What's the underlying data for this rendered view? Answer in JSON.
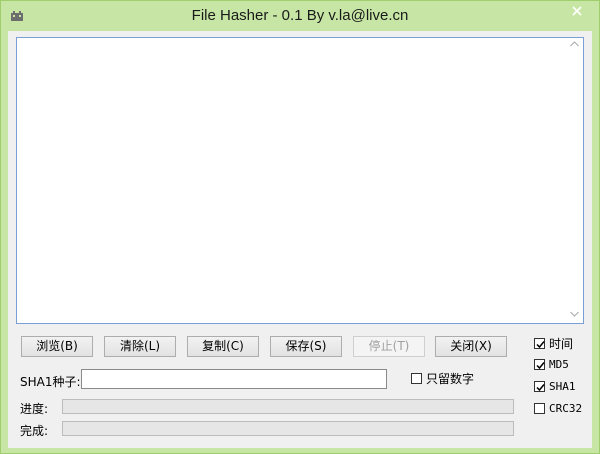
{
  "window": {
    "title": "File Hasher - 0.1 By  v.la@live.cn",
    "app_icon": "hash-app-icon",
    "close_icon": "close-icon",
    "accent_color": "#c7e6a5"
  },
  "log": {
    "content": "",
    "scroll_up_icon": "scroll-up-arrow-icon",
    "scroll_down_icon": "scroll-down-arrow-icon"
  },
  "buttons": {
    "browse": "浏览(B)",
    "clear": "清除(L)",
    "copy": "复制(C)",
    "save": "保存(S)",
    "stop": "停止(T)",
    "close": "关闭(X)"
  },
  "seed": {
    "label": "SHA1种子:",
    "value": "",
    "digits_only_label": "只留数字",
    "digits_only_checked": false
  },
  "progress": {
    "progress_label": "进度:",
    "complete_label": "完成:",
    "progress_value": 0,
    "complete_value": 0
  },
  "options": {
    "time": {
      "label": "时间",
      "checked": true
    },
    "md5": {
      "label": "MD5",
      "checked": true
    },
    "sha1": {
      "label": "SHA1",
      "checked": true
    },
    "crc32": {
      "label": "CRC32",
      "checked": false
    }
  }
}
